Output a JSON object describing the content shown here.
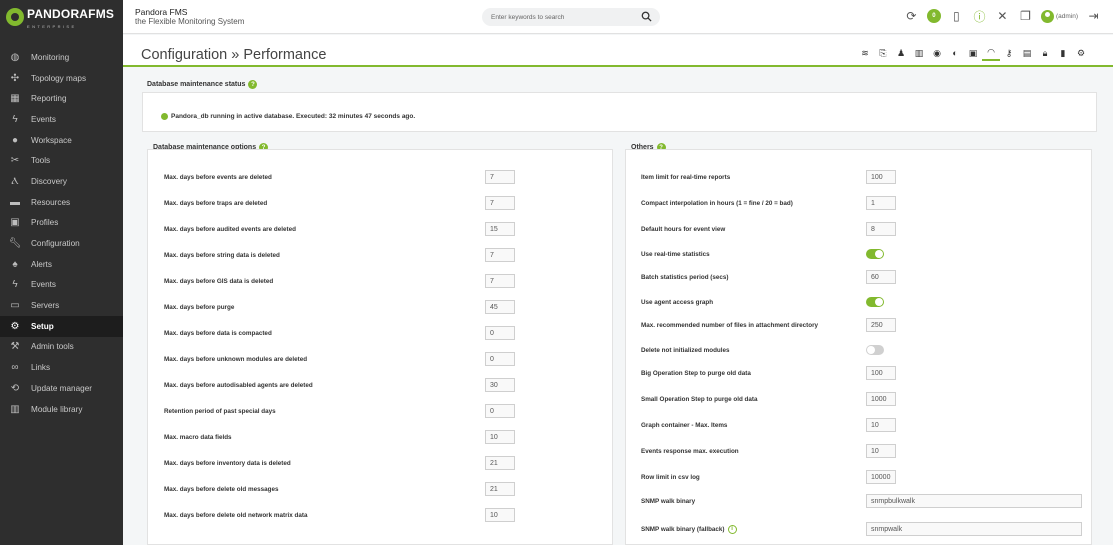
{
  "brand": {
    "logo_text": "PANDORAFMS",
    "logo_sub": "ENTERPRISE",
    "product": "Pandora FMS",
    "tagline": "the Flexible Monitoring System"
  },
  "search": {
    "placeholder": "Enter keywords to search"
  },
  "header": {
    "badge_count": "0",
    "user": "(admin)"
  },
  "sidebar": {
    "items": [
      {
        "label": "Monitoring",
        "icon": "monitoring-icon"
      },
      {
        "label": "Topology maps",
        "icon": "topology-icon"
      },
      {
        "label": "Reporting",
        "icon": "reporting-icon"
      },
      {
        "label": "Events",
        "icon": "events-icon"
      },
      {
        "label": "Workspace",
        "icon": "workspace-icon"
      },
      {
        "label": "Tools",
        "icon": "tools-icon"
      },
      {
        "label": "Discovery",
        "icon": "discovery-icon"
      },
      {
        "label": "Resources",
        "icon": "resources-icon"
      },
      {
        "label": "Profiles",
        "icon": "profiles-icon"
      },
      {
        "label": "Configuration",
        "icon": "wrench-icon"
      },
      {
        "label": "Alerts",
        "icon": "bell-icon"
      },
      {
        "label": "Events",
        "icon": "events-icon"
      },
      {
        "label": "Servers",
        "icon": "servers-icon"
      },
      {
        "label": "Setup",
        "icon": "gear-icon",
        "active": true
      },
      {
        "label": "Admin tools",
        "icon": "admin-tools-icon"
      },
      {
        "label": "Links",
        "icon": "links-icon"
      },
      {
        "label": "Update manager",
        "icon": "update-icon"
      },
      {
        "label": "Module library",
        "icon": "library-icon"
      }
    ]
  },
  "page": {
    "title": "Configuration » Performance"
  },
  "db_status": {
    "label": "Database maintenance status",
    "message": "Pandora_db running in active database. Executed: 32 minutes 47 seconds ago."
  },
  "db_options": {
    "label": "Database maintenance options",
    "rows": [
      {
        "label": "Max. days before events are deleted",
        "value": "7"
      },
      {
        "label": "Max. days before traps are deleted",
        "value": "7"
      },
      {
        "label": "Max. days before audited events are deleted",
        "value": "15"
      },
      {
        "label": "Max. days before string data is deleted",
        "value": "7"
      },
      {
        "label": "Max. days before GIS data is deleted",
        "value": "7"
      },
      {
        "label": "Max. days before purge",
        "value": "45"
      },
      {
        "label": "Max. days before data is compacted",
        "value": "0"
      },
      {
        "label": "Max. days before unknown modules are deleted",
        "value": "0"
      },
      {
        "label": "Max. days before autodisabled agents are deleted",
        "value": "30"
      },
      {
        "label": "Retention period of past special days",
        "value": "0"
      },
      {
        "label": "Max. macro data fields",
        "value": "10"
      },
      {
        "label": "Max. days before inventory data is deleted",
        "value": "21"
      },
      {
        "label": "Max. days before delete old messages",
        "value": "21"
      },
      {
        "label": "Max. days before delete old network matrix data",
        "value": "10"
      }
    ]
  },
  "others": {
    "label": "Others",
    "rows": [
      {
        "label": "Item limit for real-time reports",
        "type": "input",
        "value": "100"
      },
      {
        "label": "Compact interpolation in hours (1 = fine / 20 = bad)",
        "type": "input",
        "value": "1"
      },
      {
        "label": "Default hours for event view",
        "type": "input",
        "value": "8"
      },
      {
        "label": "Use real-time statistics",
        "type": "toggle",
        "on": true
      },
      {
        "label": "Batch statistics period (secs)",
        "type": "input",
        "value": "60"
      },
      {
        "label": "Use agent access graph",
        "type": "toggle",
        "on": true
      },
      {
        "label": "Max. recommended number of files in attachment directory",
        "type": "input",
        "value": "250"
      },
      {
        "label": "Delete not initialized modules",
        "type": "toggle",
        "on": false
      },
      {
        "label": "Big Operation Step to purge old data",
        "type": "input",
        "value": "100"
      },
      {
        "label": "Small Operation Step to purge old data",
        "type": "input",
        "value": "1000"
      },
      {
        "label": "Graph container - Max. Items",
        "type": "input",
        "value": "10"
      },
      {
        "label": "Events response max. execution",
        "type": "input",
        "value": "10"
      },
      {
        "label": "Row limit in csv log",
        "type": "input",
        "value": "10000"
      },
      {
        "label": "SNMP walk binary",
        "type": "wide",
        "value": "snmpbulkwalk"
      },
      {
        "label": "SNMP walk binary (fallback)",
        "type": "wide",
        "value": "snmpwalk",
        "info": true
      }
    ]
  },
  "colors": {
    "accent": "#82b92e",
    "sidebar": "#2e2e2e"
  }
}
